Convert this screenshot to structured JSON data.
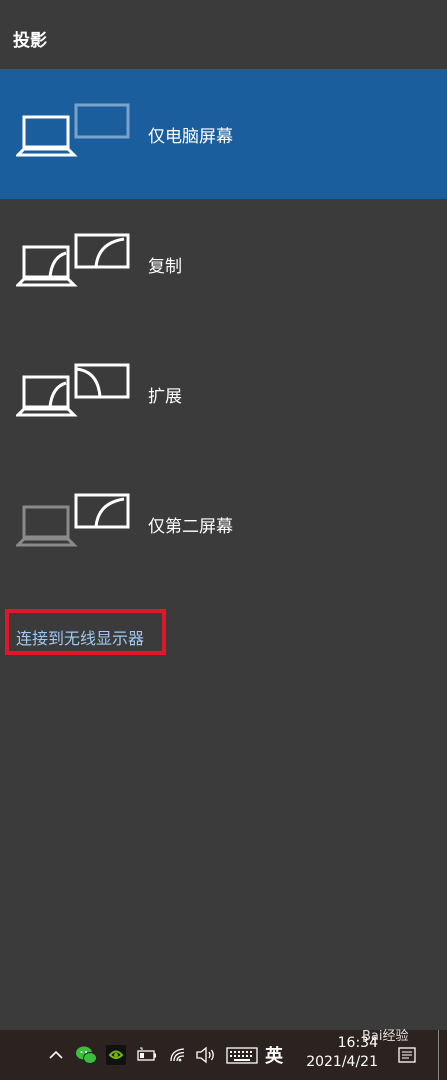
{
  "panel": {
    "title": "投影",
    "options": [
      {
        "label": "仅电脑屏幕",
        "selected": true
      },
      {
        "label": "复制",
        "selected": false
      },
      {
        "label": "扩展",
        "selected": false
      },
      {
        "label": "仅第二屏幕",
        "selected": false
      }
    ],
    "wireless_link": "连接到无线显示器"
  },
  "taskbar": {
    "ime_label": "英",
    "time": "16:34",
    "date": "2021/4/21"
  },
  "watermark": "Bai经验",
  "colors": {
    "panel_bg": "#3b3b3b",
    "selected_bg": "#1b5e9e",
    "link": "#9fc8f2",
    "highlight_box": "#e0162b",
    "taskbar_bg": "#2c2320"
  }
}
